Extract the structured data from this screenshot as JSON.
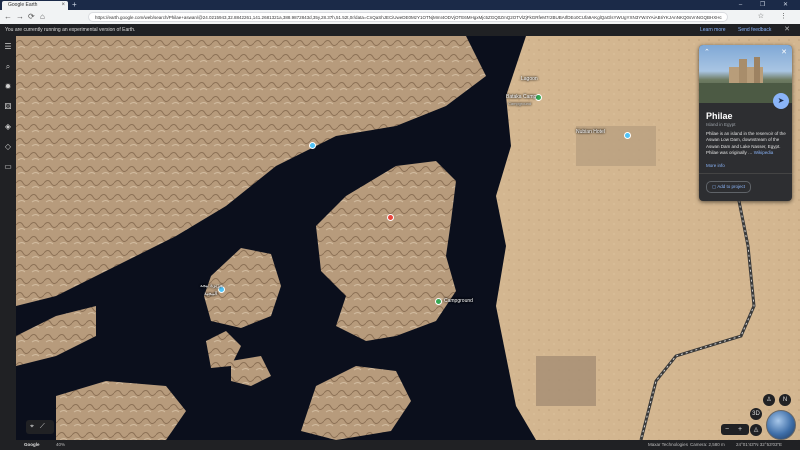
{
  "browser": {
    "tab_title": "Google Earth",
    "url": "https://earth.google.com/web/search/Philae+aswan/@24.0215943,32.8842261,141.2681321a,388.9872843d,35y,28.37h,51.52t,0r/data=CnQaShJECiUweDE0MzY1OTNjMmI4ODVjOTE6MHgxMjc5ZGQ0ZmQ2OTVlZjFkGRfeM7r2BUBAIfDEo0CUfa9AKglQaGlsYWUgYXN3YW4YAiABIiYKJAnNKQ0sVnNGQBHXHc",
    "tab_close": "×",
    "new_tab": "+",
    "window_controls": "–  ❐  ✕",
    "back": "←",
    "forward": "→",
    "reload": "⟳",
    "home": "⌂",
    "toolbar_right": "☆ ⋮"
  },
  "banner": {
    "message": "You are currently running an experimental version of Earth.",
    "learn_more": "Learn more",
    "send_feedback": "Send feedback",
    "close": "✕"
  },
  "sidebar": {
    "items": [
      "menu-icon",
      "search-icon",
      "voyager-icon",
      "feeling-lucky-icon",
      "projects-icon",
      "map-style-icon",
      "measure-icon"
    ]
  },
  "map_labels": {
    "aswan_camp": "Bataka Camp",
    "aswan_camp_sub": "Campground",
    "hotel": "Nubian Hotel",
    "island_arabic": "جزيرة بيجه",
    "island_arabic2": "البيجية",
    "campground": "Campground",
    "top_place": "Lagoon"
  },
  "card": {
    "title": "Philae",
    "subtitle": "Island in Egypt",
    "description": "Philae is an island in the reservoir of the Aswan Low Dam, downstream of the Aswan Dam and Lake Nasser, Egypt. Philae was originally …",
    "wikipedia": "Wikipedia",
    "more_info": "More info",
    "add_to_project": "Add to project",
    "share_icon": "share-icon"
  },
  "status": {
    "google_logo": "Google",
    "zoom_pct": "40%",
    "attribution": "Maxar Technologies",
    "camera": "Camera: 2,580 m",
    "coords": "24°01'43\"N 32°53'03\"E"
  },
  "controls": {
    "zoom_minus": "−",
    "zoom_plus": "+",
    "compass": "N",
    "streetview": "3D"
  },
  "colors": {
    "accent": "#8ab4f8",
    "pin_red": "#e8453c",
    "pin_green": "#34a853",
    "pin_blue": "#4fc3f7"
  }
}
